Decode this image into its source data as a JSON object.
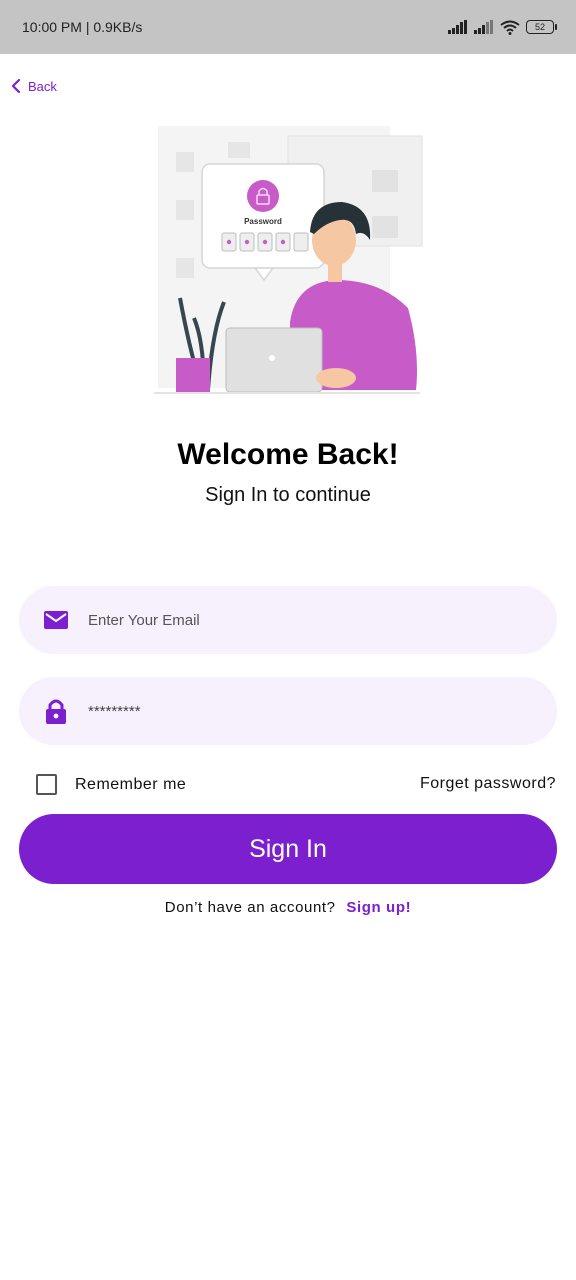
{
  "status_bar": {
    "time_speed": "10:00 PM | 0.9KB/s",
    "battery": "52"
  },
  "nav": {
    "back_label": "Back",
    "back_icon": "chevron-left-icon"
  },
  "illustration": {
    "password_label": "Password"
  },
  "header": {
    "title": "Welcome Back!",
    "subtitle": "Sign In to continue"
  },
  "form": {
    "email": {
      "placeholder": "Enter Your Email",
      "value": "",
      "icon": "mail-icon"
    },
    "password": {
      "value": "*********",
      "icon": "lock-icon"
    },
    "remember_label": "Remember me",
    "remember_checked": false,
    "forget_label": "Forget password?",
    "submit_label": "Sign In"
  },
  "footer": {
    "prompt": "Don’t have an account?",
    "signup_label": "Sign up!"
  },
  "colors": {
    "accent": "#7b1fcf",
    "field_bg": "#f7f0fd",
    "status_bg": "#c4c4c4"
  }
}
